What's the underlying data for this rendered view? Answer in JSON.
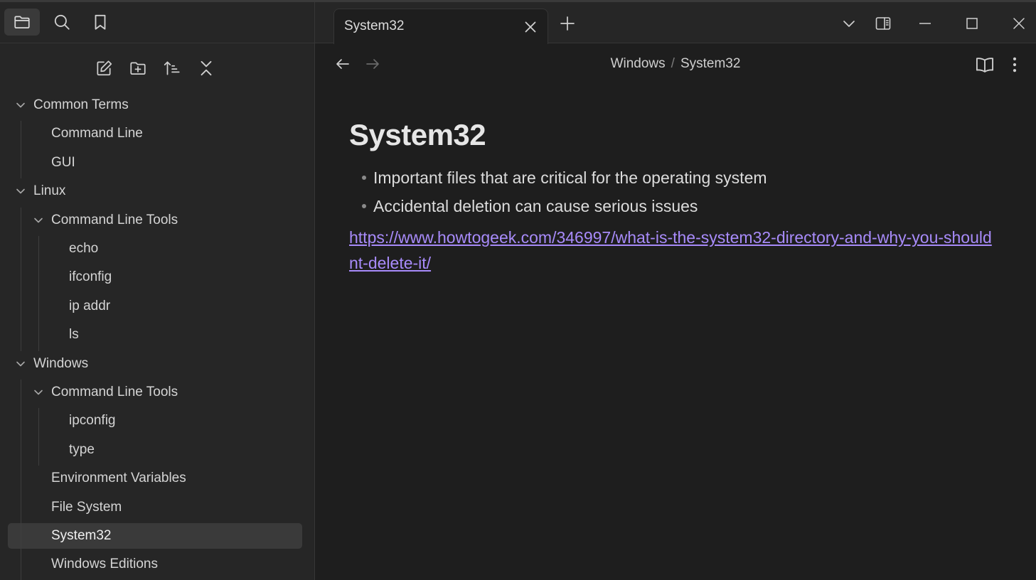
{
  "sidebar": {
    "tabs": [
      {
        "name": "files",
        "icon": "folder-icon"
      },
      {
        "name": "search",
        "icon": "search-icon"
      },
      {
        "name": "bookmarks",
        "icon": "bookmark-icon"
      }
    ],
    "actions": [
      {
        "name": "new-note",
        "icon": "edit-icon"
      },
      {
        "name": "new-folder",
        "icon": "folder-plus-icon"
      },
      {
        "name": "sort",
        "icon": "sort-icon"
      },
      {
        "name": "collapse-all",
        "icon": "collapse-all-icon"
      }
    ],
    "tree": [
      {
        "label": "Common Terms",
        "level": 0,
        "folder": true,
        "expanded": true
      },
      {
        "label": "Command Line",
        "level": 1,
        "folder": false
      },
      {
        "label": "GUI",
        "level": 1,
        "folder": false
      },
      {
        "label": "Linux",
        "level": 0,
        "folder": true,
        "expanded": true
      },
      {
        "label": "Command Line Tools",
        "level": 1,
        "folder": true,
        "expanded": true
      },
      {
        "label": "echo",
        "level": 2,
        "folder": false
      },
      {
        "label": "ifconfig",
        "level": 2,
        "folder": false
      },
      {
        "label": "ip addr",
        "level": 2,
        "folder": false
      },
      {
        "label": "ls",
        "level": 2,
        "folder": false
      },
      {
        "label": "Windows",
        "level": 0,
        "folder": true,
        "expanded": true
      },
      {
        "label": "Command Line Tools",
        "level": 1,
        "folder": true,
        "expanded": true
      },
      {
        "label": "ipconfig",
        "level": 2,
        "folder": false
      },
      {
        "label": "type",
        "level": 2,
        "folder": false
      },
      {
        "label": "Environment Variables",
        "level": 1,
        "folder": false
      },
      {
        "label": "File System",
        "level": 1,
        "folder": false
      },
      {
        "label": "System32",
        "level": 1,
        "folder": false,
        "selected": true
      },
      {
        "label": "Windows Editions",
        "level": 1,
        "folder": false
      }
    ]
  },
  "tabbar": {
    "active_tab": "System32"
  },
  "navbar": {
    "breadcrumb": [
      "Windows",
      "System32"
    ]
  },
  "document": {
    "title": "System32",
    "bullets": [
      "Important files that are critical for the operating system",
      "Accidental deletion can cause serious issues"
    ],
    "link": "https://www.howtogeek.com/346997/what-is-the-system32-directory-and-why-you-shouldnt-delete-it/"
  },
  "colors": {
    "sidebar_bg": "#262626",
    "editor_bg": "#1e1e1e",
    "selected_bg": "#3a3a3a",
    "link": "#a88bfa",
    "text": "#dadada"
  }
}
